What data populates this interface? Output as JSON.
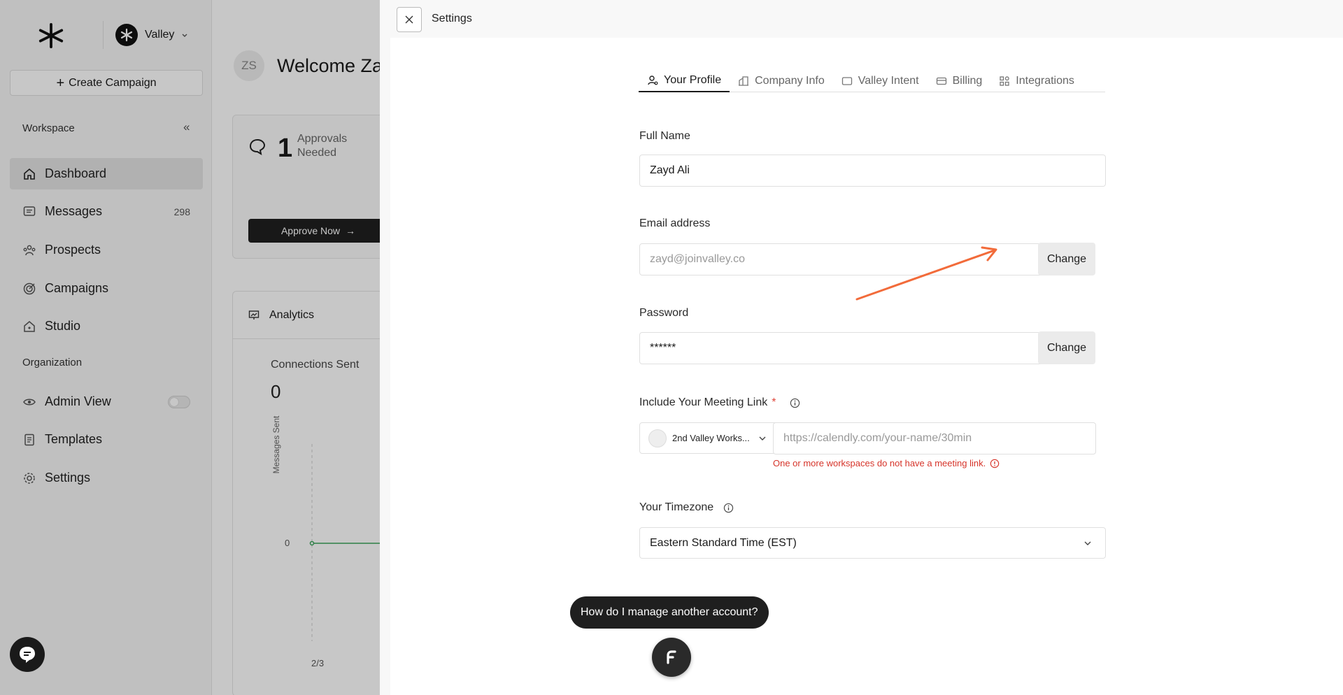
{
  "workspace": {
    "name": "Valley"
  },
  "sidebar": {
    "create_label": "Create Campaign",
    "workspace_section": "Workspace",
    "organization_section": "Organization",
    "items": [
      {
        "label": "Dashboard",
        "icon": "home-icon"
      },
      {
        "label": "Messages",
        "icon": "message-icon",
        "count": "298"
      },
      {
        "label": "Prospects",
        "icon": "people-icon"
      },
      {
        "label": "Campaigns",
        "icon": "target-icon"
      },
      {
        "label": "Studio",
        "icon": "studio-icon"
      }
    ],
    "org_items": [
      {
        "label": "Admin View",
        "icon": "eye-icon"
      },
      {
        "label": "Templates",
        "icon": "document-icon"
      },
      {
        "label": "Settings",
        "icon": "gear-icon"
      }
    ]
  },
  "dashboard": {
    "user_initials": "ZS",
    "welcome": "Welcome Zay",
    "approvals_count": "1",
    "approvals_label": "Approvals Needed",
    "approve_button": "Approve Now",
    "analytics_title": "Analytics",
    "connections_label": "Connections Sent",
    "connections_value": "0",
    "y_axis_label": "Messages Sent",
    "y_tick": "0",
    "x_tick": "2/3"
  },
  "settings": {
    "title": "Settings",
    "tabs": [
      {
        "label": "Your Profile",
        "icon": "user-icon"
      },
      {
        "label": "Company Info",
        "icon": "building-icon"
      },
      {
        "label": "Valley Intent",
        "icon": "window-icon"
      },
      {
        "label": "Billing",
        "icon": "card-icon"
      },
      {
        "label": "Integrations",
        "icon": "apps-icon"
      }
    ],
    "full_name_label": "Full Name",
    "full_name_value": "Zayd Ali",
    "email_label": "Email address",
    "email_placeholder": "zayd@joinvalley.co",
    "change_label": "Change",
    "password_label": "Password",
    "password_value": "******",
    "meeting_label": "Include Your Meeting Link",
    "required_mark": "*",
    "workspace_select": "2nd Valley Works...",
    "meeting_placeholder": "https://calendly.com/your-name/30min",
    "meeting_error": "One or more workspaces do not have a meeting link.",
    "timezone_label": "Your Timezone",
    "timezone_value": "Eastern Standard Time (EST)"
  },
  "help": {
    "bubble_text": "How do I manage another account?"
  },
  "colors": {
    "accent_arrow": "#f26b3a",
    "error": "#d6342a",
    "dark": "#1f1f1f"
  }
}
